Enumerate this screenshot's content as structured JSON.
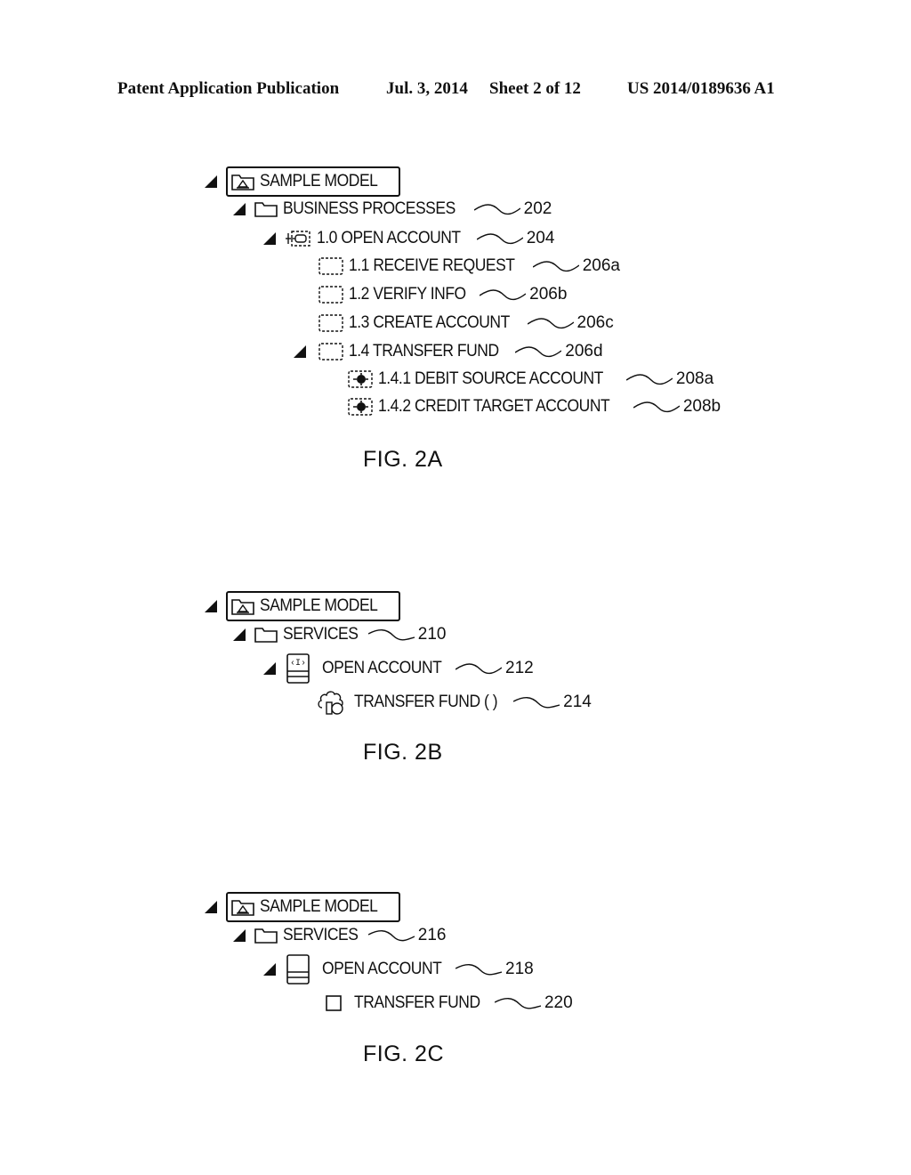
{
  "header": {
    "publication": "Patent Application Publication",
    "date": "Jul. 3, 2014",
    "sheet": "Sheet 2 of 12",
    "number": "US 2014/0189636 A1"
  },
  "fig2a": {
    "caption": "FIG. 2A",
    "root": "SAMPLE MODEL",
    "items": [
      {
        "label": "BUSINESS PROCESSES",
        "ref": "202"
      },
      {
        "label": "1.0 OPEN ACCOUNT",
        "ref": "204"
      },
      {
        "label": "1.1 RECEIVE REQUEST",
        "ref": "206a"
      },
      {
        "label": "1.2 VERIFY INFO",
        "ref": "206b"
      },
      {
        "label": "1.3 CREATE ACCOUNT",
        "ref": "206c"
      },
      {
        "label": "1.4 TRANSFER FUND",
        "ref": "206d"
      },
      {
        "label": "1.4.1 DEBIT SOURCE ACCOUNT",
        "ref": "208a"
      },
      {
        "label": "1.4.2 CREDIT TARGET ACCOUNT",
        "ref": "208b"
      }
    ]
  },
  "fig2b": {
    "caption": "FIG. 2B",
    "root": "SAMPLE MODEL",
    "items": [
      {
        "label": "SERVICES",
        "ref": "210"
      },
      {
        "label": "OPEN ACCOUNT",
        "ref": "212"
      },
      {
        "label": "TRANSFER FUND ( )",
        "ref": "214"
      }
    ]
  },
  "fig2c": {
    "caption": "FIG. 2C",
    "root": "SAMPLE MODEL",
    "items": [
      {
        "label": "SERVICES",
        "ref": "216"
      },
      {
        "label": "OPEN ACCOUNT",
        "ref": "218"
      },
      {
        "label": "TRANSFER FUND",
        "ref": "220"
      }
    ]
  }
}
